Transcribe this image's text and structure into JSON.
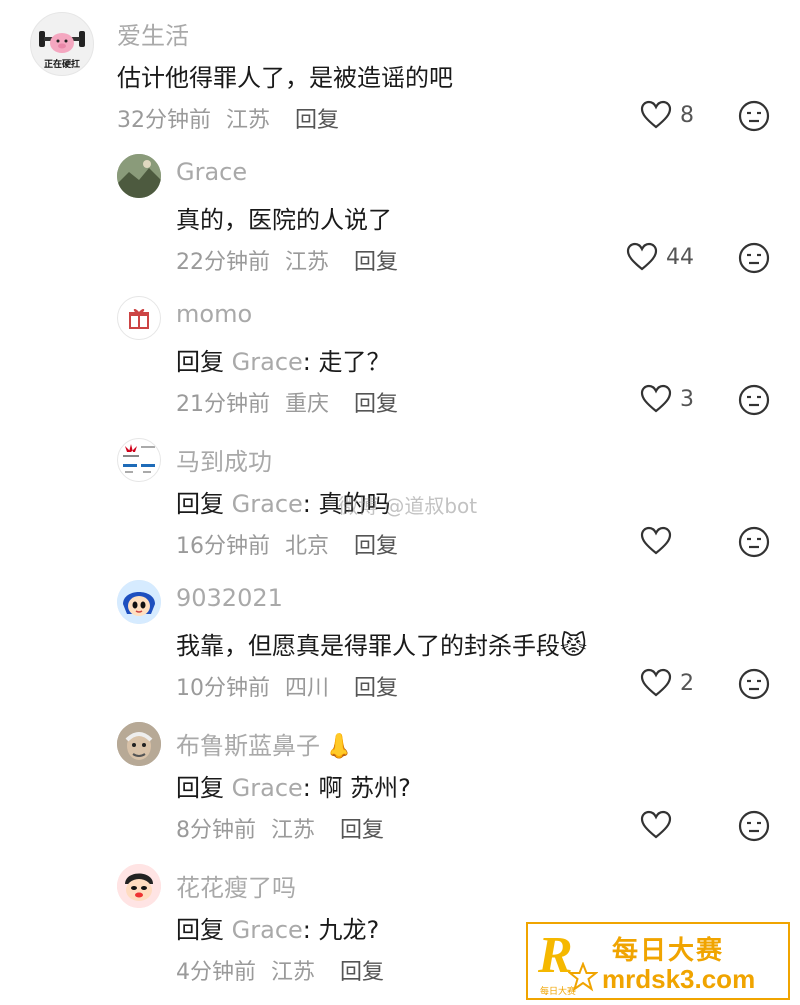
{
  "comments": [
    {
      "name": "爱生活",
      "avatar_label": "正在硬扛",
      "avatar_icon": "dumbbell-pig-icon",
      "text": "估计他得罪人了，是被造谣的吧",
      "time": "32分钟前",
      "location": "江苏",
      "reply_label": "回复",
      "likes": "8"
    },
    {
      "name": "Grace",
      "avatar_icon": "landscape-photo-icon",
      "text": "真的，医院的人说了",
      "time": "22分钟前",
      "location": "江苏",
      "reply_label": "回复",
      "likes": "44"
    },
    {
      "name": "momo",
      "avatar_icon": "gift-box-icon",
      "reply_prefix": "回复",
      "mention": "Grace",
      "text_after": ": 走了？",
      "time": "21分钟前",
      "location": "重庆",
      "reply_label": "回复",
      "likes": "3"
    },
    {
      "name": "马到成功",
      "avatar_icon": "huawei-logo-icon",
      "reply_prefix": "回复",
      "mention": "Grace",
      "text_after": ": 真的吗",
      "time": "16分钟前",
      "location": "北京",
      "reply_label": "回复",
      "likes": ""
    },
    {
      "name": "9032021",
      "avatar_icon": "cartoon-girl-icon",
      "text": "我靠，但愿真是得罪人了的封杀手段",
      "emoji": "😾",
      "time": "10分钟前",
      "location": "四川",
      "reply_label": "回复",
      "likes": "2"
    },
    {
      "name": "布鲁斯蓝鼻子",
      "name_emoji": "👃",
      "avatar_icon": "old-man-photo-icon",
      "reply_prefix": "回复",
      "mention": "Grace",
      "text_after": ": 啊 苏州?",
      "time": "8分钟前",
      "location": "江苏",
      "reply_label": "回复",
      "likes": ""
    },
    {
      "name": "花花瘦了吗",
      "avatar_icon": "cartoon-boy-icon",
      "reply_prefix": "回复",
      "mention": "Grace",
      "text_after": ": 九龙?",
      "time": "4分钟前",
      "location": "江苏",
      "reply_label": "回复",
      "likes": ""
    }
  ],
  "watermark": "微博 @道叔bot",
  "promo": {
    "logo_letter": "R",
    "logo_sub": "每日大赛",
    "title": "每日大赛",
    "url": "mrdsk3.com",
    "color": "#f0a400"
  }
}
